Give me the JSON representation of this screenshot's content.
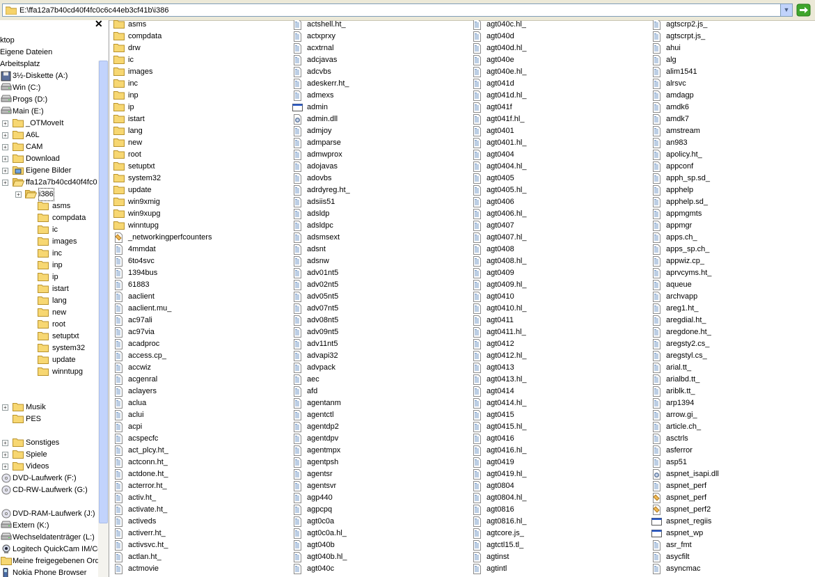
{
  "address": {
    "path": "E:\\ffa12a7b40cd40f4fc0c6c44eb3cf41b\\i386"
  },
  "tree": [
    {
      "label": "ktop",
      "level": 0,
      "icon": "none",
      "expander": false
    },
    {
      "label": "Eigene Dateien",
      "level": 0,
      "icon": "none",
      "expander": false
    },
    {
      "label": "Arbeitsplatz",
      "level": 0,
      "icon": "none",
      "expander": false
    },
    {
      "label": "3½-Diskette (A:)",
      "level": 1,
      "icon": "floppy",
      "expander": false
    },
    {
      "label": "Win (C:)",
      "level": 1,
      "icon": "drive",
      "expander": false
    },
    {
      "label": "Progs (D:)",
      "level": 1,
      "icon": "drive",
      "expander": false
    },
    {
      "label": "Main (E:)",
      "level": 1,
      "icon": "drive",
      "expander": false
    },
    {
      "label": "_OTMoveIt",
      "level": 2,
      "icon": "folder",
      "expander": true
    },
    {
      "label": "A6L",
      "level": 2,
      "icon": "folder",
      "expander": true
    },
    {
      "label": "CAM",
      "level": 2,
      "icon": "folder",
      "expander": true
    },
    {
      "label": "Download",
      "level": 2,
      "icon": "folder",
      "expander": true
    },
    {
      "label": "Eigene Bilder",
      "level": 2,
      "icon": "pictures",
      "expander": true
    },
    {
      "label": "ffa12a7b40cd40f4fc0",
      "level": 2,
      "icon": "folder-open",
      "expander": true
    },
    {
      "label": "i386",
      "level": 3,
      "icon": "folder-open",
      "expander": true,
      "selected": true
    },
    {
      "label": "asms",
      "level": 4,
      "icon": "folder",
      "expander": false
    },
    {
      "label": "compdata",
      "level": 4,
      "icon": "folder",
      "expander": false
    },
    {
      "label": "ic",
      "level": 4,
      "icon": "folder",
      "expander": false
    },
    {
      "label": "images",
      "level": 4,
      "icon": "folder",
      "expander": false
    },
    {
      "label": "inc",
      "level": 4,
      "icon": "folder",
      "expander": false
    },
    {
      "label": "inp",
      "level": 4,
      "icon": "folder",
      "expander": false
    },
    {
      "label": "ip",
      "level": 4,
      "icon": "folder",
      "expander": false
    },
    {
      "label": "istart",
      "level": 4,
      "icon": "folder",
      "expander": false
    },
    {
      "label": "lang",
      "level": 4,
      "icon": "folder",
      "expander": false
    },
    {
      "label": "new",
      "level": 4,
      "icon": "folder",
      "expander": false
    },
    {
      "label": "root",
      "level": 4,
      "icon": "folder",
      "expander": false
    },
    {
      "label": "setuptxt",
      "level": 4,
      "icon": "folder",
      "expander": false
    },
    {
      "label": "system32",
      "level": 4,
      "icon": "folder",
      "expander": false
    },
    {
      "label": "update",
      "level": 4,
      "icon": "folder",
      "expander": false
    },
    {
      "label": "winntupg",
      "level": 4,
      "icon": "folder",
      "expander": false
    },
    {
      "label": "",
      "level": 0,
      "icon": "none",
      "expander": false
    },
    {
      "label": "",
      "level": 0,
      "icon": "none",
      "expander": false
    },
    {
      "label": "Musik",
      "level": 2,
      "icon": "folder",
      "expander": true
    },
    {
      "label": "PES",
      "level": 2,
      "icon": "folder",
      "expander": false
    },
    {
      "label": "",
      "level": 0,
      "icon": "none",
      "expander": false
    },
    {
      "label": "Sonstiges",
      "level": 2,
      "icon": "folder",
      "expander": true
    },
    {
      "label": "Spiele",
      "level": 2,
      "icon": "folder",
      "expander": true
    },
    {
      "label": "Videos",
      "level": 2,
      "icon": "folder",
      "expander": true
    },
    {
      "label": "DVD-Laufwerk (F:)",
      "level": 1,
      "icon": "cd",
      "expander": false
    },
    {
      "label": "CD-RW-Laufwerk (G:)",
      "level": 1,
      "icon": "cd",
      "expander": false
    },
    {
      "label": "",
      "level": 0,
      "icon": "none",
      "expander": false
    },
    {
      "label": "DVD-RAM-Laufwerk (J:)",
      "level": 1,
      "icon": "cd",
      "expander": false
    },
    {
      "label": "Extern (K:)",
      "level": 1,
      "icon": "drive",
      "expander": false
    },
    {
      "label": "Wechseldatenträger (L:)",
      "level": 1,
      "icon": "drive",
      "expander": false
    },
    {
      "label": "Logitech QuickCam IM/Co",
      "level": 1,
      "icon": "camera",
      "expander": false
    },
    {
      "label": "Meine freigegebenen Ord",
      "level": 1,
      "icon": "folder",
      "expander": false
    },
    {
      "label": "Nokia Phone Browser",
      "level": 1,
      "icon": "phone",
      "expander": false
    }
  ],
  "files": [
    [
      {
        "n": "asms",
        "t": "folder"
      },
      {
        "n": "compdata",
        "t": "folder"
      },
      {
        "n": "drw",
        "t": "folder"
      },
      {
        "n": "ic",
        "t": "folder"
      },
      {
        "n": "images",
        "t": "folder"
      },
      {
        "n": "inc",
        "t": "folder"
      },
      {
        "n": "inp",
        "t": "folder"
      },
      {
        "n": "ip",
        "t": "folder"
      },
      {
        "n": "istart",
        "t": "folder"
      },
      {
        "n": "lang",
        "t": "folder"
      },
      {
        "n": "new",
        "t": "folder"
      },
      {
        "n": "root",
        "t": "folder"
      },
      {
        "n": "setuptxt",
        "t": "folder"
      },
      {
        "n": "system32",
        "t": "folder"
      },
      {
        "n": "update",
        "t": "folder"
      },
      {
        "n": "win9xmig",
        "t": "folder"
      },
      {
        "n": "win9xupg",
        "t": "folder"
      },
      {
        "n": "winntupg",
        "t": "folder"
      },
      {
        "n": "_networkingperfcounters",
        "t": "special"
      },
      {
        "n": "4mmdat",
        "t": "file"
      },
      {
        "n": "6to4svc",
        "t": "file"
      },
      {
        "n": "1394bus",
        "t": "file"
      },
      {
        "n": "61883",
        "t": "file"
      },
      {
        "n": "aaclient",
        "t": "file"
      },
      {
        "n": "aaclient.mu_",
        "t": "file"
      },
      {
        "n": "ac97ali",
        "t": "file"
      },
      {
        "n": "ac97via",
        "t": "file"
      },
      {
        "n": "acadproc",
        "t": "file"
      },
      {
        "n": "access.cp_",
        "t": "file"
      },
      {
        "n": "accwiz",
        "t": "file"
      },
      {
        "n": "acgenral",
        "t": "file"
      },
      {
        "n": "aclayers",
        "t": "file"
      },
      {
        "n": "aclua",
        "t": "file"
      },
      {
        "n": "aclui",
        "t": "file"
      },
      {
        "n": "acpi",
        "t": "file"
      },
      {
        "n": "acspecfc",
        "t": "file"
      },
      {
        "n": "act_plcy.ht_",
        "t": "file"
      },
      {
        "n": "actconn.ht_",
        "t": "file"
      },
      {
        "n": "actdone.ht_",
        "t": "file"
      },
      {
        "n": "acterror.ht_",
        "t": "file"
      },
      {
        "n": "activ.ht_",
        "t": "file"
      },
      {
        "n": "activate.ht_",
        "t": "file"
      },
      {
        "n": "activeds",
        "t": "file"
      },
      {
        "n": "activerr.ht_",
        "t": "file"
      },
      {
        "n": "activsvc.ht_",
        "t": "file"
      },
      {
        "n": "actlan.ht_",
        "t": "file"
      },
      {
        "n": "actmovie",
        "t": "file"
      }
    ],
    [
      {
        "n": "actshell.ht_",
        "t": "file"
      },
      {
        "n": "actxprxy",
        "t": "file"
      },
      {
        "n": "acxtrnal",
        "t": "file"
      },
      {
        "n": "adcjavas",
        "t": "file"
      },
      {
        "n": "adcvbs",
        "t": "file"
      },
      {
        "n": "adeskerr.ht_",
        "t": "file"
      },
      {
        "n": "admexs",
        "t": "file"
      },
      {
        "n": "admin",
        "t": "window"
      },
      {
        "n": "admin.dll",
        "t": "dll"
      },
      {
        "n": "admjoy",
        "t": "file"
      },
      {
        "n": "admparse",
        "t": "file"
      },
      {
        "n": "admwprox",
        "t": "file"
      },
      {
        "n": "adojavas",
        "t": "file"
      },
      {
        "n": "adovbs",
        "t": "file"
      },
      {
        "n": "adrdyreg.ht_",
        "t": "file"
      },
      {
        "n": "adsiis51",
        "t": "file"
      },
      {
        "n": "adsldp",
        "t": "file"
      },
      {
        "n": "adsldpc",
        "t": "file"
      },
      {
        "n": "adsmsext",
        "t": "file"
      },
      {
        "n": "adsnt",
        "t": "file"
      },
      {
        "n": "adsnw",
        "t": "file"
      },
      {
        "n": "adv01nt5",
        "t": "file"
      },
      {
        "n": "adv02nt5",
        "t": "file"
      },
      {
        "n": "adv05nt5",
        "t": "file"
      },
      {
        "n": "adv07nt5",
        "t": "file"
      },
      {
        "n": "adv08nt5",
        "t": "file"
      },
      {
        "n": "adv09nt5",
        "t": "file"
      },
      {
        "n": "adv11nt5",
        "t": "file"
      },
      {
        "n": "advapi32",
        "t": "file"
      },
      {
        "n": "advpack",
        "t": "file"
      },
      {
        "n": "aec",
        "t": "file"
      },
      {
        "n": "afd",
        "t": "file"
      },
      {
        "n": "agentanm",
        "t": "file"
      },
      {
        "n": "agentctl",
        "t": "file"
      },
      {
        "n": "agentdp2",
        "t": "file"
      },
      {
        "n": "agentdpv",
        "t": "file"
      },
      {
        "n": "agentmpx",
        "t": "file"
      },
      {
        "n": "agentpsh",
        "t": "file"
      },
      {
        "n": "agentsr",
        "t": "file"
      },
      {
        "n": "agentsvr",
        "t": "file"
      },
      {
        "n": "agp440",
        "t": "file"
      },
      {
        "n": "agpcpq",
        "t": "file"
      },
      {
        "n": "agt0c0a",
        "t": "file"
      },
      {
        "n": "agt0c0a.hl_",
        "t": "file"
      },
      {
        "n": "agt040b",
        "t": "file"
      },
      {
        "n": "agt040b.hl_",
        "t": "file"
      },
      {
        "n": "agt040c",
        "t": "file"
      }
    ],
    [
      {
        "n": "agt040c.hl_",
        "t": "file"
      },
      {
        "n": "agt040d",
        "t": "file"
      },
      {
        "n": "agt040d.hl_",
        "t": "file"
      },
      {
        "n": "agt040e",
        "t": "file"
      },
      {
        "n": "agt040e.hl_",
        "t": "file"
      },
      {
        "n": "agt041d",
        "t": "file"
      },
      {
        "n": "agt041d.hl_",
        "t": "file"
      },
      {
        "n": "agt041f",
        "t": "file"
      },
      {
        "n": "agt041f.hl_",
        "t": "file"
      },
      {
        "n": "agt0401",
        "t": "file"
      },
      {
        "n": "agt0401.hl_",
        "t": "file"
      },
      {
        "n": "agt0404",
        "t": "file"
      },
      {
        "n": "agt0404.hl_",
        "t": "file"
      },
      {
        "n": "agt0405",
        "t": "file"
      },
      {
        "n": "agt0405.hl_",
        "t": "file"
      },
      {
        "n": "agt0406",
        "t": "file"
      },
      {
        "n": "agt0406.hl_",
        "t": "file"
      },
      {
        "n": "agt0407",
        "t": "file"
      },
      {
        "n": "agt0407.hl_",
        "t": "file"
      },
      {
        "n": "agt0408",
        "t": "file"
      },
      {
        "n": "agt0408.hl_",
        "t": "file"
      },
      {
        "n": "agt0409",
        "t": "file"
      },
      {
        "n": "agt0409.hl_",
        "t": "file"
      },
      {
        "n": "agt0410",
        "t": "file"
      },
      {
        "n": "agt0410.hl_",
        "t": "file"
      },
      {
        "n": "agt0411",
        "t": "file"
      },
      {
        "n": "agt0411.hl_",
        "t": "file"
      },
      {
        "n": "agt0412",
        "t": "file"
      },
      {
        "n": "agt0412.hl_",
        "t": "file"
      },
      {
        "n": "agt0413",
        "t": "file"
      },
      {
        "n": "agt0413.hl_",
        "t": "file"
      },
      {
        "n": "agt0414",
        "t": "file"
      },
      {
        "n": "agt0414.hl_",
        "t": "file"
      },
      {
        "n": "agt0415",
        "t": "file"
      },
      {
        "n": "agt0415.hl_",
        "t": "file"
      },
      {
        "n": "agt0416",
        "t": "file"
      },
      {
        "n": "agt0416.hl_",
        "t": "file"
      },
      {
        "n": "agt0419",
        "t": "file"
      },
      {
        "n": "agt0419.hl_",
        "t": "file"
      },
      {
        "n": "agt0804",
        "t": "file"
      },
      {
        "n": "agt0804.hl_",
        "t": "file"
      },
      {
        "n": "agt0816",
        "t": "file"
      },
      {
        "n": "agt0816.hl_",
        "t": "file"
      },
      {
        "n": "agtcore.js_",
        "t": "file"
      },
      {
        "n": "agtctl15.tl_",
        "t": "file"
      },
      {
        "n": "agtinst",
        "t": "file"
      },
      {
        "n": "agtintl",
        "t": "file"
      }
    ],
    [
      {
        "n": "agtscrp2.js_",
        "t": "file"
      },
      {
        "n": "agtscrpt.js_",
        "t": "file"
      },
      {
        "n": "ahui",
        "t": "file"
      },
      {
        "n": "alg",
        "t": "file"
      },
      {
        "n": "alim1541",
        "t": "file"
      },
      {
        "n": "alrsvc",
        "t": "file"
      },
      {
        "n": "amdagp",
        "t": "file"
      },
      {
        "n": "amdk6",
        "t": "file"
      },
      {
        "n": "amdk7",
        "t": "file"
      },
      {
        "n": "amstream",
        "t": "file"
      },
      {
        "n": "an983",
        "t": "file"
      },
      {
        "n": "apolicy.ht_",
        "t": "file"
      },
      {
        "n": "appconf",
        "t": "file"
      },
      {
        "n": "apph_sp.sd_",
        "t": "file"
      },
      {
        "n": "apphelp",
        "t": "file"
      },
      {
        "n": "apphelp.sd_",
        "t": "file"
      },
      {
        "n": "appmgmts",
        "t": "file"
      },
      {
        "n": "appmgr",
        "t": "file"
      },
      {
        "n": "apps.ch_",
        "t": "file"
      },
      {
        "n": "apps_sp.ch_",
        "t": "file"
      },
      {
        "n": "appwiz.cp_",
        "t": "file"
      },
      {
        "n": "aprvcyms.ht_",
        "t": "file"
      },
      {
        "n": "aqueue",
        "t": "file"
      },
      {
        "n": "archvapp",
        "t": "file"
      },
      {
        "n": "areg1.ht_",
        "t": "file"
      },
      {
        "n": "aregdial.ht_",
        "t": "file"
      },
      {
        "n": "aregdone.ht_",
        "t": "file"
      },
      {
        "n": "aregsty2.cs_",
        "t": "file"
      },
      {
        "n": "aregstyl.cs_",
        "t": "file"
      },
      {
        "n": "arial.tt_",
        "t": "file"
      },
      {
        "n": "arialbd.tt_",
        "t": "file"
      },
      {
        "n": "ariblk.tt_",
        "t": "file"
      },
      {
        "n": "arp1394",
        "t": "file"
      },
      {
        "n": "arrow.gi_",
        "t": "file"
      },
      {
        "n": "article.ch_",
        "t": "file"
      },
      {
        "n": "asctrls",
        "t": "file"
      },
      {
        "n": "asferror",
        "t": "file"
      },
      {
        "n": "asp51",
        "t": "file"
      },
      {
        "n": "aspnet_isapi.dll",
        "t": "dll"
      },
      {
        "n": "aspnet_perf",
        "t": "file"
      },
      {
        "n": "aspnet_perf",
        "t": "special"
      },
      {
        "n": "aspnet_perf2",
        "t": "special"
      },
      {
        "n": "aspnet_regiis",
        "t": "window"
      },
      {
        "n": "aspnet_wp",
        "t": "window"
      },
      {
        "n": "asr_fmt",
        "t": "file"
      },
      {
        "n": "asycfilt",
        "t": "file"
      },
      {
        "n": "asyncmac",
        "t": "file"
      }
    ]
  ]
}
